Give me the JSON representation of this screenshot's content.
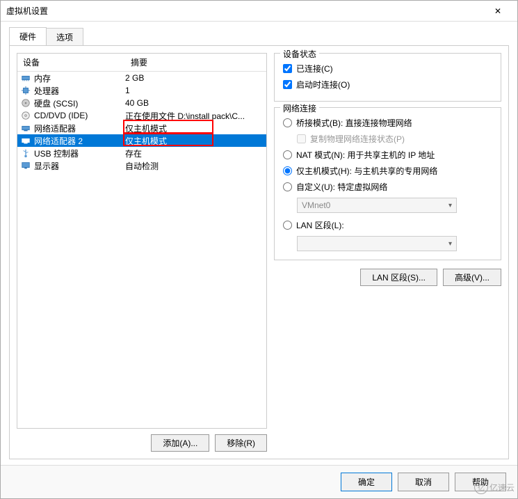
{
  "window": {
    "title": "虚拟机设置"
  },
  "tabs": {
    "hardware": "硬件",
    "options": "选项"
  },
  "list": {
    "header_device": "设备",
    "header_summary": "摘要",
    "rows": [
      {
        "icon": "memory",
        "name": "内存",
        "summary": "2 GB",
        "selected": false
      },
      {
        "icon": "cpu",
        "name": "处理器",
        "summary": "1",
        "selected": false
      },
      {
        "icon": "disk",
        "name": "硬盘 (SCSI)",
        "summary": "40 GB",
        "selected": false
      },
      {
        "icon": "cd",
        "name": "CD/DVD (IDE)",
        "summary": "正在使用文件 D:\\install pack\\C...",
        "selected": false
      },
      {
        "icon": "net",
        "name": "网络适配器",
        "summary": "仅主机模式",
        "selected": false
      },
      {
        "icon": "net",
        "name": "网络适配器 2",
        "summary": "仅主机模式",
        "selected": true
      },
      {
        "icon": "usb",
        "name": "USB 控制器",
        "summary": "存在",
        "selected": false
      },
      {
        "icon": "display",
        "name": "显示器",
        "summary": "自动检测",
        "selected": false
      }
    ],
    "add_btn": "添加(A)...",
    "remove_btn": "移除(R)"
  },
  "status_group": {
    "title": "设备状态",
    "connected": "已连接(C)",
    "connect_on_start": "启动时连接(O)"
  },
  "net_group": {
    "title": "网络连接",
    "bridged": "桥接模式(B): 直接连接物理网络",
    "replicate": "复制物理网络连接状态(P)",
    "nat": "NAT 模式(N): 用于共享主机的 IP 地址",
    "hostonly": "仅主机模式(H): 与主机共享的专用网络",
    "custom": "自定义(U): 特定虚拟网络",
    "custom_value": "VMnet0",
    "lan": "LAN 区段(L):",
    "lan_value": ""
  },
  "right_buttons": {
    "lan_segment": "LAN 区段(S)...",
    "advanced": "高级(V)..."
  },
  "footer": {
    "ok": "确定",
    "cancel": "取消",
    "help": "帮助"
  },
  "watermark": "亿速云"
}
